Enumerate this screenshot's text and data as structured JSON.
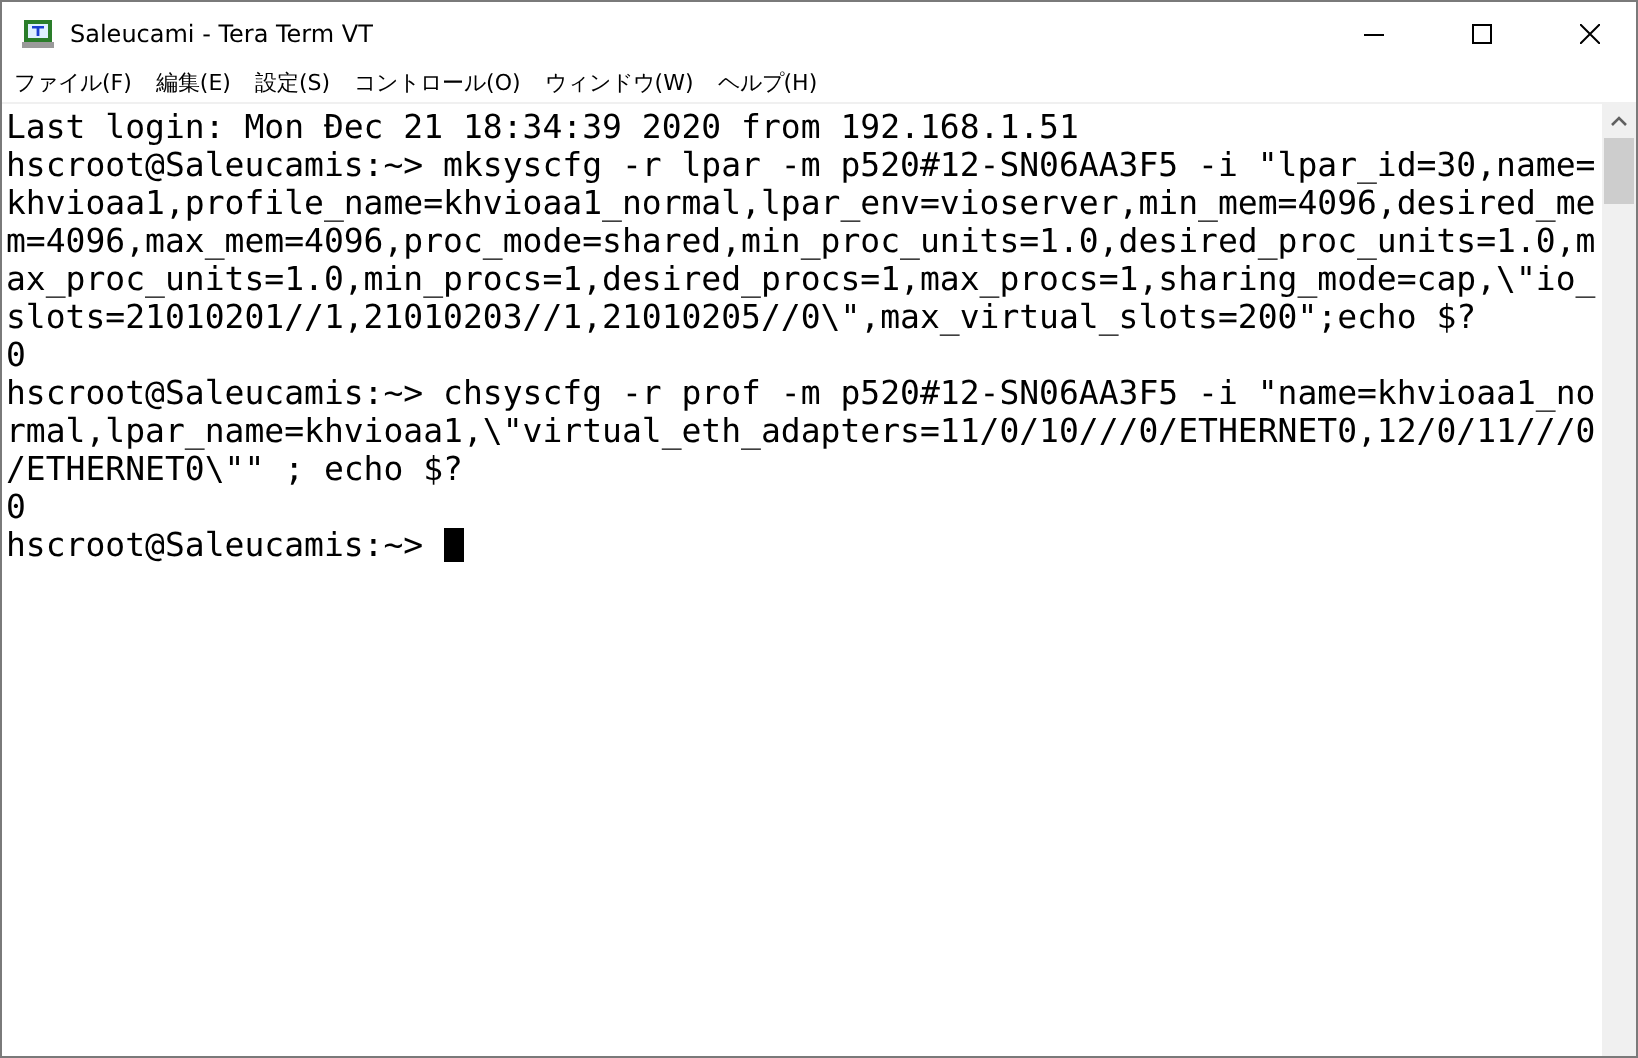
{
  "window": {
    "title": "Saleucami - Tera Term VT"
  },
  "menu": [
    "ファイル(F)",
    "編集(E)",
    "設定(S)",
    "コントロール(O)",
    "ウィンドウ(W)",
    "ヘルプ(H)"
  ],
  "terminal": {
    "lines": [
      "Last login: Mon Đec 21 18:34:39 2020 from 192.168.1.51",
      "hscroot@Saleucamis:~> mksyscfg -r lpar -m p520#12-SN06AA3F5 -i \"lpar_id=30,name=",
      "khvioaa1,profile_name=khvioaa1_normal,lpar_env=vioserver,min_mem=4096,desired_me",
      "m=4096,max_mem=4096,proc_mode=shared,min_proc_units=1.0,desired_proc_units=1.0,m",
      "ax_proc_units=1.0,min_procs=1,desired_procs=1,max_procs=1,sharing_mode=cap,\\\"io_",
      "slots=21010201//1,21010203//1,21010205//0\\\",max_virtual_slots=200\";echo $?",
      "0",
      "hscroot@Saleucamis:~> chsyscfg -r prof -m p520#12-SN06AA3F5 -i \"name=khvioaa1_no",
      "rmal,lpar_name=khvioaa1,\\\"virtual_eth_adapters=11/0/10///0/ETHERNET0,12/0/11///0",
      "/ETHERNET0\\\"\" ; echo $?",
      "0"
    ],
    "prompt": "hscroot@Saleucamis:~>"
  }
}
